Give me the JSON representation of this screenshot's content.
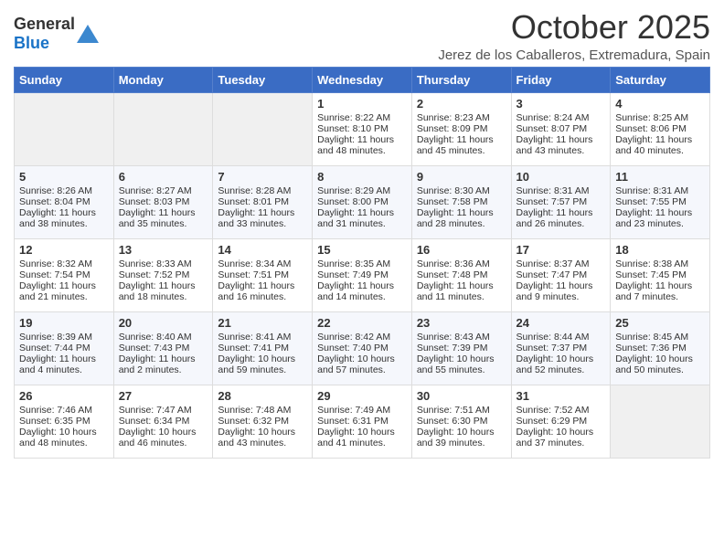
{
  "header": {
    "logo_general": "General",
    "logo_blue": "Blue",
    "month": "October 2025",
    "location": "Jerez de los Caballeros, Extremadura, Spain"
  },
  "weekdays": [
    "Sunday",
    "Monday",
    "Tuesday",
    "Wednesday",
    "Thursday",
    "Friday",
    "Saturday"
  ],
  "weeks": [
    [
      {
        "day": "",
        "info": ""
      },
      {
        "day": "",
        "info": ""
      },
      {
        "day": "",
        "info": ""
      },
      {
        "day": "1",
        "info": "Sunrise: 8:22 AM\nSunset: 8:10 PM\nDaylight: 11 hours and 48 minutes."
      },
      {
        "day": "2",
        "info": "Sunrise: 8:23 AM\nSunset: 8:09 PM\nDaylight: 11 hours and 45 minutes."
      },
      {
        "day": "3",
        "info": "Sunrise: 8:24 AM\nSunset: 8:07 PM\nDaylight: 11 hours and 43 minutes."
      },
      {
        "day": "4",
        "info": "Sunrise: 8:25 AM\nSunset: 8:06 PM\nDaylight: 11 hours and 40 minutes."
      }
    ],
    [
      {
        "day": "5",
        "info": "Sunrise: 8:26 AM\nSunset: 8:04 PM\nDaylight: 11 hours and 38 minutes."
      },
      {
        "day": "6",
        "info": "Sunrise: 8:27 AM\nSunset: 8:03 PM\nDaylight: 11 hours and 35 minutes."
      },
      {
        "day": "7",
        "info": "Sunrise: 8:28 AM\nSunset: 8:01 PM\nDaylight: 11 hours and 33 minutes."
      },
      {
        "day": "8",
        "info": "Sunrise: 8:29 AM\nSunset: 8:00 PM\nDaylight: 11 hours and 31 minutes."
      },
      {
        "day": "9",
        "info": "Sunrise: 8:30 AM\nSunset: 7:58 PM\nDaylight: 11 hours and 28 minutes."
      },
      {
        "day": "10",
        "info": "Sunrise: 8:31 AM\nSunset: 7:57 PM\nDaylight: 11 hours and 26 minutes."
      },
      {
        "day": "11",
        "info": "Sunrise: 8:31 AM\nSunset: 7:55 PM\nDaylight: 11 hours and 23 minutes."
      }
    ],
    [
      {
        "day": "12",
        "info": "Sunrise: 8:32 AM\nSunset: 7:54 PM\nDaylight: 11 hours and 21 minutes."
      },
      {
        "day": "13",
        "info": "Sunrise: 8:33 AM\nSunset: 7:52 PM\nDaylight: 11 hours and 18 minutes."
      },
      {
        "day": "14",
        "info": "Sunrise: 8:34 AM\nSunset: 7:51 PM\nDaylight: 11 hours and 16 minutes."
      },
      {
        "day": "15",
        "info": "Sunrise: 8:35 AM\nSunset: 7:49 PM\nDaylight: 11 hours and 14 minutes."
      },
      {
        "day": "16",
        "info": "Sunrise: 8:36 AM\nSunset: 7:48 PM\nDaylight: 11 hours and 11 minutes."
      },
      {
        "day": "17",
        "info": "Sunrise: 8:37 AM\nSunset: 7:47 PM\nDaylight: 11 hours and 9 minutes."
      },
      {
        "day": "18",
        "info": "Sunrise: 8:38 AM\nSunset: 7:45 PM\nDaylight: 11 hours and 7 minutes."
      }
    ],
    [
      {
        "day": "19",
        "info": "Sunrise: 8:39 AM\nSunset: 7:44 PM\nDaylight: 11 hours and 4 minutes."
      },
      {
        "day": "20",
        "info": "Sunrise: 8:40 AM\nSunset: 7:43 PM\nDaylight: 11 hours and 2 minutes."
      },
      {
        "day": "21",
        "info": "Sunrise: 8:41 AM\nSunset: 7:41 PM\nDaylight: 10 hours and 59 minutes."
      },
      {
        "day": "22",
        "info": "Sunrise: 8:42 AM\nSunset: 7:40 PM\nDaylight: 10 hours and 57 minutes."
      },
      {
        "day": "23",
        "info": "Sunrise: 8:43 AM\nSunset: 7:39 PM\nDaylight: 10 hours and 55 minutes."
      },
      {
        "day": "24",
        "info": "Sunrise: 8:44 AM\nSunset: 7:37 PM\nDaylight: 10 hours and 52 minutes."
      },
      {
        "day": "25",
        "info": "Sunrise: 8:45 AM\nSunset: 7:36 PM\nDaylight: 10 hours and 50 minutes."
      }
    ],
    [
      {
        "day": "26",
        "info": "Sunrise: 7:46 AM\nSunset: 6:35 PM\nDaylight: 10 hours and 48 minutes."
      },
      {
        "day": "27",
        "info": "Sunrise: 7:47 AM\nSunset: 6:34 PM\nDaylight: 10 hours and 46 minutes."
      },
      {
        "day": "28",
        "info": "Sunrise: 7:48 AM\nSunset: 6:32 PM\nDaylight: 10 hours and 43 minutes."
      },
      {
        "day": "29",
        "info": "Sunrise: 7:49 AM\nSunset: 6:31 PM\nDaylight: 10 hours and 41 minutes."
      },
      {
        "day": "30",
        "info": "Sunrise: 7:51 AM\nSunset: 6:30 PM\nDaylight: 10 hours and 39 minutes."
      },
      {
        "day": "31",
        "info": "Sunrise: 7:52 AM\nSunset: 6:29 PM\nDaylight: 10 hours and 37 minutes."
      },
      {
        "day": "",
        "info": ""
      }
    ]
  ]
}
